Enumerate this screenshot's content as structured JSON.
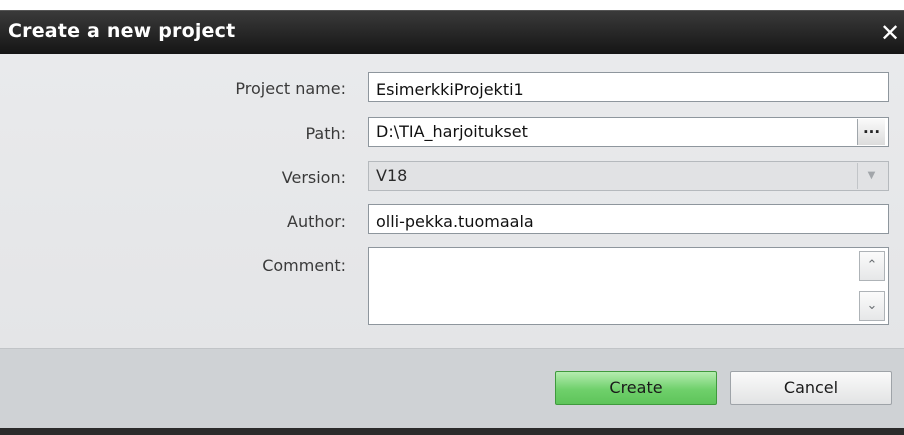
{
  "dialog": {
    "title": "Create a new project",
    "close_icon": "close-icon",
    "close_glyph": "✕"
  },
  "form": {
    "project_name_label": "Project name:",
    "project_name_value": "EsimerkkiProjekti1",
    "path_label": "Path:",
    "path_value": "D:\\TIA_harjoitukset",
    "browse_label": "...",
    "version_label": "Version:",
    "version_value": "V18",
    "author_label": "Author:",
    "author_value": "olli-pekka.tuomaala",
    "comment_label": "Comment:",
    "comment_value": "",
    "scroll_up_glyph": "⌃",
    "scroll_down_glyph": "⌄",
    "dropdown_glyph": "▼"
  },
  "buttons": {
    "create_label": "Create",
    "cancel_label": "Cancel"
  },
  "colors": {
    "titlebar": "#1c1c1c",
    "body": "#e7e8ea",
    "footer": "#cfd2d5",
    "create_button": "#6fd06b"
  }
}
